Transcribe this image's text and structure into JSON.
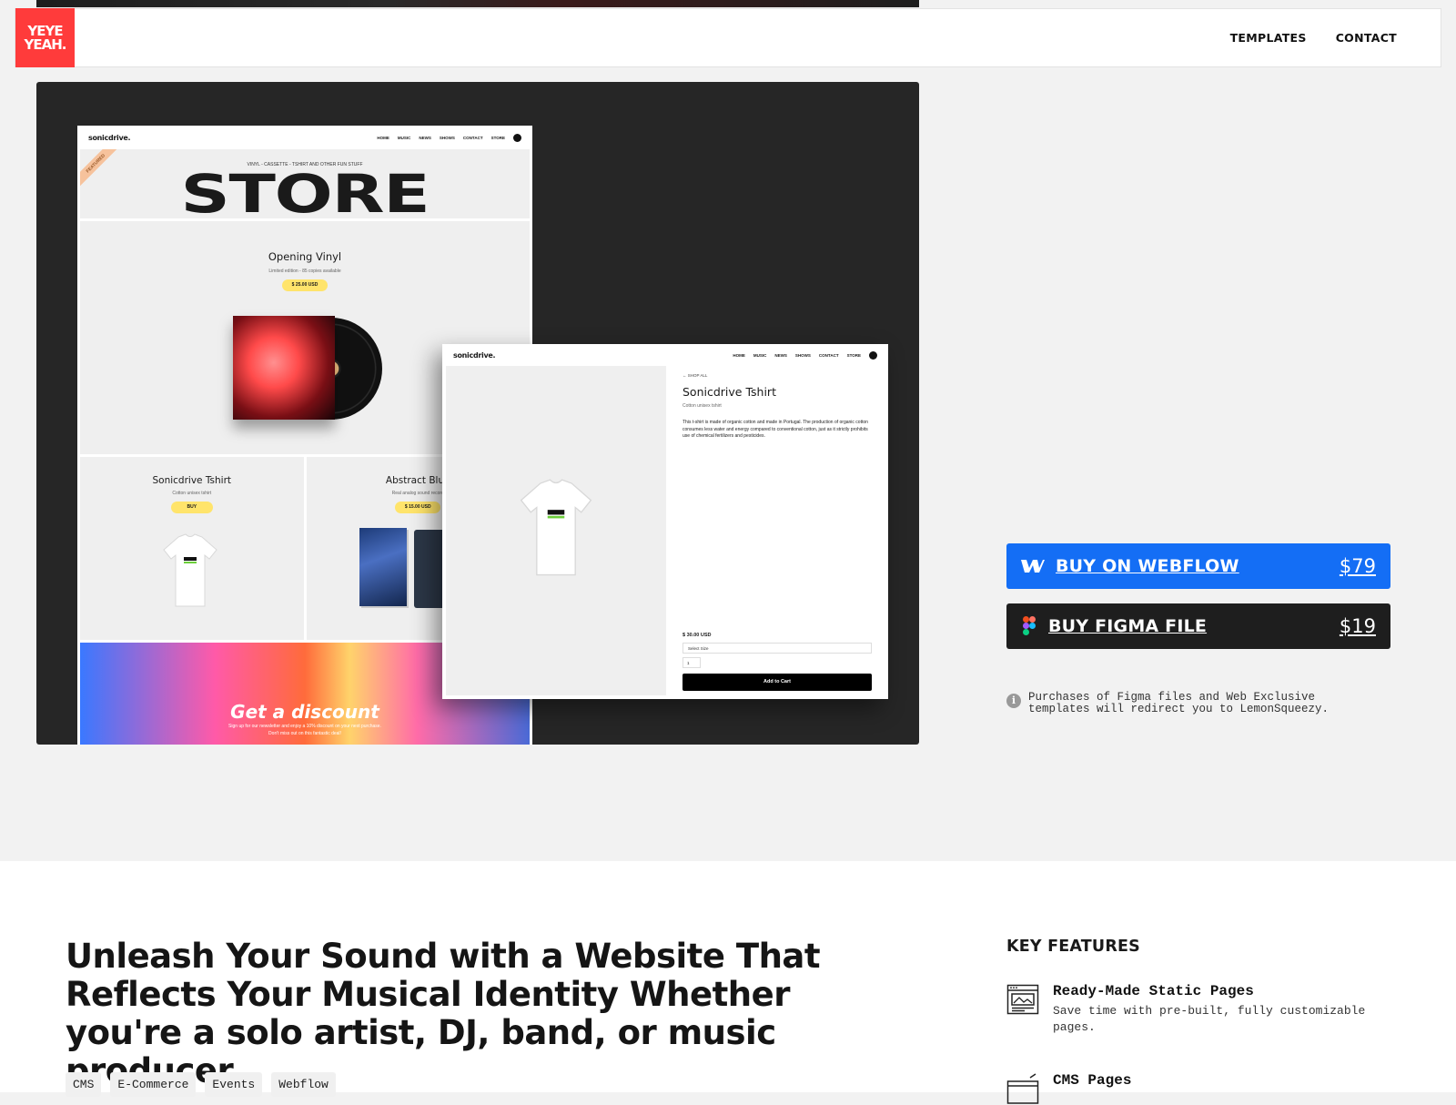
{
  "header": {
    "logo_line1": "YEYE",
    "logo_line2": "YEAH.",
    "nav": [
      "TEMPLATES",
      "CONTACT"
    ]
  },
  "preview": {
    "store_page": {
      "brand": "sonicdrive.",
      "nav": [
        "HOME",
        "MUSIC",
        "NEWS",
        "SHOWS",
        "CONTACT",
        "STORE"
      ],
      "ribbon": "FEATURED",
      "subtitle": "VINYL - CASSETTE - TSHIRT AND OTHER FUN STUFF",
      "title": "STORE",
      "vinyl": {
        "title": "Opening Vinyl",
        "subtitle": "Limited edition - 85 copies available",
        "price": "$ 25.00 USD"
      },
      "tshirt": {
        "title": "Sonicdrive Tshirt",
        "subtitle": "Cotton unisex tshirt",
        "price": "BUY"
      },
      "cassette": {
        "title": "Abstract Blue",
        "subtitle": "Real analog sound record",
        "price": "$ 15.00 USD"
      },
      "discount": {
        "title": "Get a discount",
        "line1": "Sign up for our newsletter and enjoy a 10% discount on your next purchase.",
        "line2": "Don't miss out on this fantastic deal!"
      }
    },
    "product_page": {
      "brand": "sonicdrive.",
      "nav": [
        "HOME",
        "MUSIC",
        "NEWS",
        "SHOWS",
        "CONTACT",
        "STORE"
      ],
      "breadcrumb": "← SHOP ALL",
      "title": "Sonicdrive Tshirt",
      "subtitle": "Cotton unisex tshirt",
      "description": "This t-shirt is made of organic cotton and made in Portugal. The production of organic cotton consumes less water and energy compared to conventional cotton, just as it strictly prohibits use of chemical fertilizers and pesticides.",
      "price": "$ 30.00 USD",
      "size_placeholder": "Select Size",
      "qty": "1",
      "cart_button": "Add to Cart"
    }
  },
  "purchase": {
    "webflow_label": "BUY ON WEBFLOW",
    "webflow_price": "$79",
    "figma_label": "BUY FIGMA FILE",
    "figma_price": "$19",
    "note": "Purchases of Figma files and Web Exclusive templates will redirect you to LemonSqueezy.",
    "colors": {
      "webflow": "#146ef5",
      "figma": "#1e1e1e"
    }
  },
  "about": {
    "headline": "Unleash Your Sound with a Website That Reflects Your Musical Identity Whether you're a solo artist, DJ, band, or music producer.",
    "tags": [
      "CMS",
      "E-Commerce",
      "Events",
      "Webflow"
    ]
  },
  "features": {
    "title": "KEY FEATURES",
    "items": [
      {
        "title": "Ready-Made Static Pages",
        "desc": "Save time with pre-built, fully customizable pages.",
        "icon": "static-pages-icon"
      },
      {
        "title": "CMS Pages",
        "desc": "",
        "icon": "cms-pages-icon"
      }
    ]
  }
}
